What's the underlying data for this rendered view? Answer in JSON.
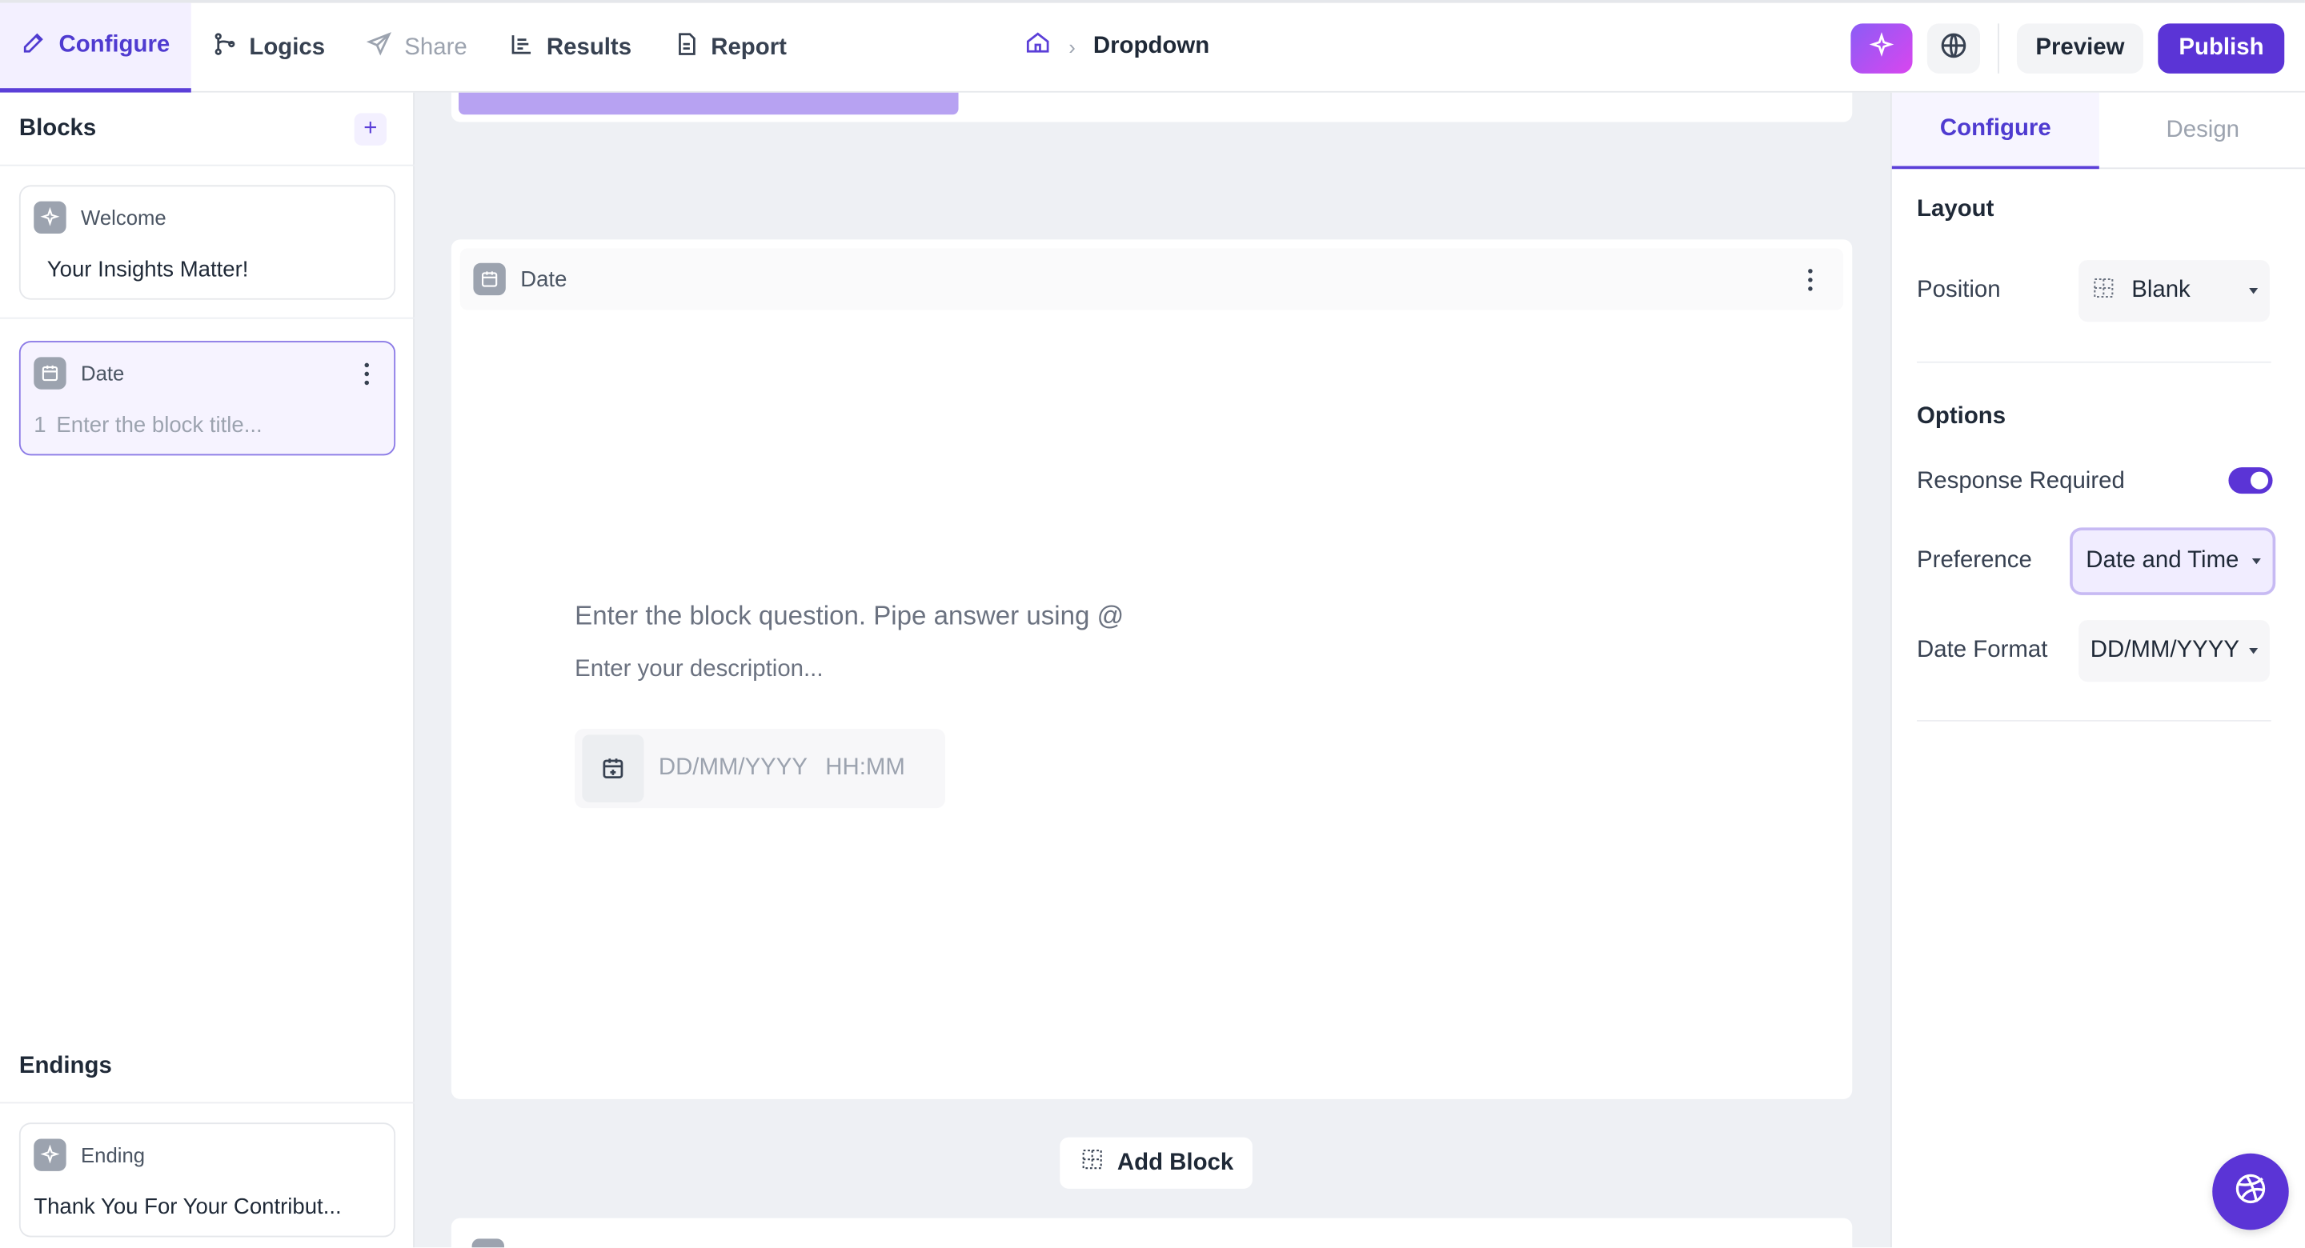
{
  "topbar": {
    "tabs": [
      {
        "label": "Configure",
        "icon": "pencil-icon",
        "state": "active"
      },
      {
        "label": "Logics",
        "icon": "git-branch-icon",
        "state": "normal"
      },
      {
        "label": "Share",
        "icon": "send-icon",
        "state": "disabled"
      },
      {
        "label": "Results",
        "icon": "bar-chart-icon",
        "state": "normal"
      },
      {
        "label": "Report",
        "icon": "document-icon",
        "state": "normal"
      }
    ],
    "breadcrumb": {
      "home_icon": "home-icon",
      "separator": "›",
      "title": "Dropdown"
    },
    "preview_label": "Preview",
    "publish_label": "Publish"
  },
  "sidebar": {
    "blocks_heading": "Blocks",
    "add_label": "+",
    "blocks": [
      {
        "type": "Welcome",
        "icon": "sparkle-icon",
        "title": "Your Insights Matter!"
      },
      {
        "type": "Date",
        "icon": "calendar-icon",
        "number": "1",
        "title_placeholder": "Enter the block title..."
      }
    ],
    "endings_heading": "Endings",
    "endings": [
      {
        "type": "Ending",
        "icon": "sparkle-icon",
        "title": "Thank You For Your Contribut..."
      }
    ]
  },
  "canvas": {
    "date_card": {
      "type": "Date",
      "question_placeholder": "Enter the block question. Pipe answer using @",
      "description_placeholder": "Enter your description...",
      "date_placeholder": "DD/MM/YYYY HH:MM"
    },
    "add_block_label": "Add Block"
  },
  "right_panel": {
    "tabs": [
      {
        "label": "Configure",
        "state": "active"
      },
      {
        "label": "Design",
        "state": "inactive"
      }
    ],
    "layout_heading": "Layout",
    "position_label": "Position",
    "position_value": "Blank",
    "options_heading": "Options",
    "response_required_label": "Response Required",
    "response_required": true,
    "preference_label": "Preference",
    "preference_value": "Date and Time",
    "date_format_label": "Date Format",
    "date_format_value": "DD/MM/YYYY"
  },
  "colors": {
    "accent": "#5b34d6",
    "accent_light": "#f3f0ff",
    "canvas_bg": "#eef0f4"
  }
}
